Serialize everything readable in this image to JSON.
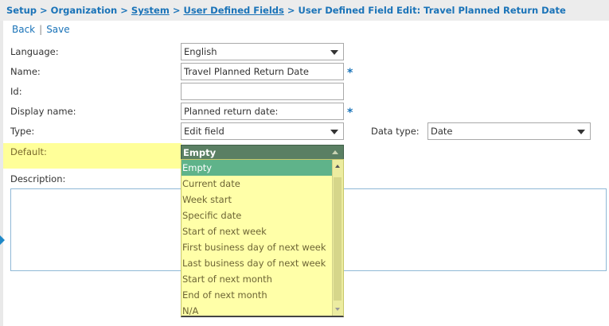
{
  "breadcrumb": {
    "setup": "Setup",
    "organization": "Organization",
    "system": "System",
    "user_defined_fields": "User Defined Fields",
    "current": "User Defined Field Edit: Travel Planned Return Date",
    "separator": ">"
  },
  "actions": {
    "back": "Back",
    "separator": "|",
    "save": "Save"
  },
  "form": {
    "language": {
      "label": "Language:",
      "value": "English"
    },
    "name": {
      "label": "Name:",
      "value": "Travel Planned Return Date",
      "required": "*"
    },
    "id": {
      "label": "Id:",
      "value": ""
    },
    "display_name": {
      "label": "Display name:",
      "value": "Planned return date:",
      "required": "*"
    },
    "type": {
      "label": "Type:",
      "value": "Edit field"
    },
    "data_type": {
      "label": "Data type:",
      "value": "Date"
    },
    "default": {
      "label": "Default:",
      "value": "Empty"
    },
    "description": {
      "label": "Description:",
      "value": ""
    }
  },
  "default_options": [
    "Empty",
    "Current date",
    "Week start",
    "Specific date",
    "Start of next week",
    "First business day of next week",
    "Last business day of next week",
    "Start of next month",
    "End of next month",
    "N/A"
  ],
  "colors": {
    "link": "#1a73b8",
    "highlight": "#ffff99",
    "dropdown_bg": "#ffffa8",
    "selected_option": "#5fb38a"
  }
}
